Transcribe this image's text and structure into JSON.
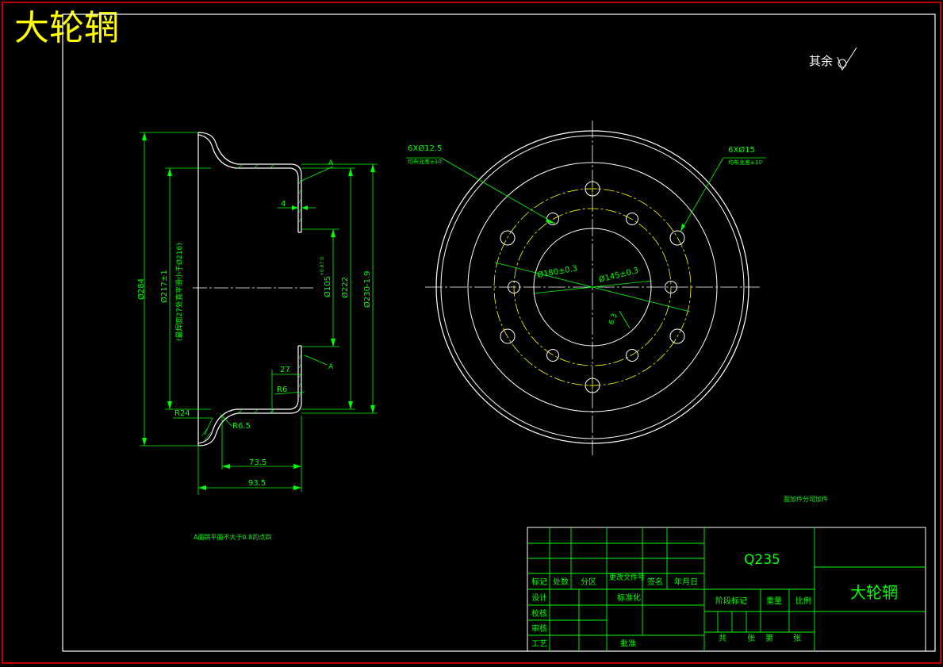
{
  "colors": {
    "background": "#000000",
    "frame": "#ffffff",
    "red_frame": "#ff0000",
    "dim": "#00ff00",
    "center": "#ffff00",
    "title": "#ffff00"
  },
  "drawing": {
    "title_big": "大轮辋",
    "roughness": {
      "label": "其余",
      "icon": "surface-roughness-icon"
    },
    "note_hardness": "A面跳平面不大于0.8的点四",
    "note_misc": "面加件分司加件",
    "section": {
      "d_outer": "Ø284",
      "d_flange": "Ø217±1",
      "d_flange_note": "(最焊面27处直平滑小于Ø216)",
      "thickness": "4",
      "d_hub_bore": "Ø105",
      "d_hub_bore_tol": "+0.87\n0",
      "d_inner": "Ø222",
      "d_rim": "Ø230-1.9",
      "len_27": "27",
      "r6": "R6",
      "r24": "R24",
      "r6_5": "R6.5",
      "len_73_5": "73.5",
      "len_93_5": "93.5",
      "datum_a": "A",
      "datum_a2": "A"
    },
    "plan": {
      "holes_small": "6XØ12.5",
      "holes_small_note": "均布允差±10'",
      "holes_large": "6XØ15",
      "holes_large_note": "均布允差±10'",
      "d_pcd_180": "Ø180±0.3",
      "d_pcd_145": "Ø145±0.3",
      "r_6_3": "6.3"
    }
  },
  "title_block": {
    "material": "Q235",
    "part_name": "大轮辋",
    "header_labels": [
      "标记",
      "处数",
      "分区",
      "更改文件号",
      "签名",
      "年月日"
    ],
    "row_labels": [
      "设计",
      "校核",
      "审核",
      "工艺"
    ],
    "standardization": "标准化",
    "approval": "批准",
    "stage_mark": "阶段标记",
    "weight": "重量",
    "scale": "比例",
    "sheets": [
      "共",
      "张",
      "第",
      "张"
    ]
  }
}
